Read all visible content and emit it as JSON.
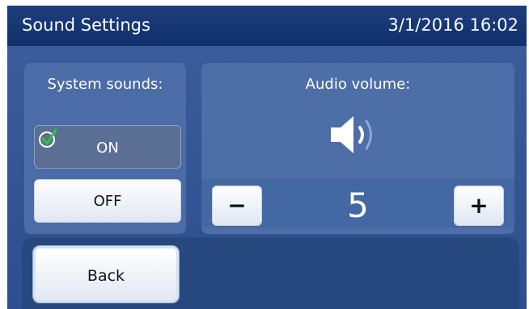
{
  "header": {
    "title": "Sound Settings",
    "datetime": "3/1/2016 16:02"
  },
  "system_sounds": {
    "label": "System sounds:",
    "on_label": "ON",
    "off_label": "OFF",
    "selected": "ON",
    "check_icon": "check-icon"
  },
  "audio_volume": {
    "label": "Audio volume:",
    "value": "5",
    "minus_label": "−",
    "plus_label": "+",
    "speaker_icon": "speaker-icon"
  },
  "footer": {
    "back_label": "Back"
  },
  "colors": {
    "header_bg": "#1d3d7c",
    "body_bg": "#3a5c9a",
    "check_green": "#3ac23a"
  }
}
